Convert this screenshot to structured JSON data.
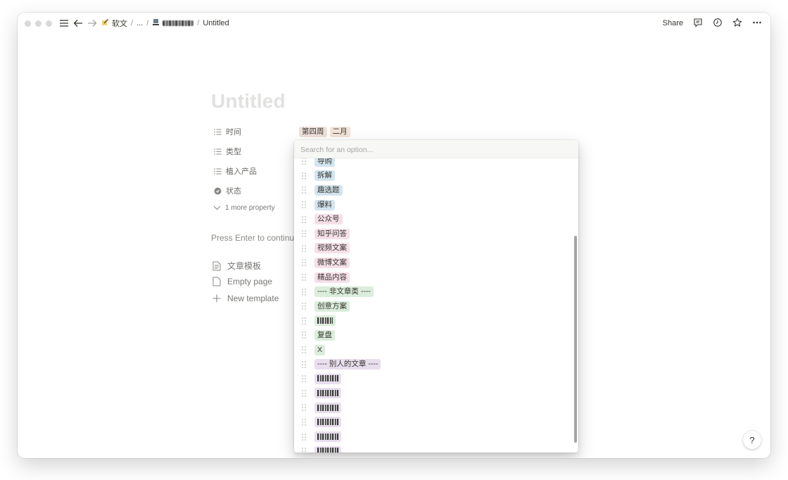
{
  "topbar": {
    "breadcrumb": [
      {
        "label": "软文",
        "icon": "pencil-note-icon"
      },
      {
        "label": "..."
      },
      {
        "label": "",
        "icon": "document-stack-icon",
        "redacted": true
      },
      {
        "label": "Untitled"
      }
    ],
    "share_label": "Share"
  },
  "page": {
    "title_placeholder": "Untitled",
    "properties": [
      {
        "label": "时间",
        "icon": "list-icon",
        "tags": [
          {
            "text": "第四周",
            "color": "#eee0da"
          },
          {
            "text": "二月",
            "color": "#f3e4d8"
          }
        ]
      },
      {
        "label": "类型",
        "icon": "list-icon",
        "tags": []
      },
      {
        "label": "植入产品",
        "icon": "list-icon",
        "tags": []
      },
      {
        "label": "状态",
        "icon": "status-icon",
        "tags": []
      }
    ],
    "more_properties": "1 more property",
    "enter_hint": "Press Enter to continue",
    "templates": [
      {
        "label": "文章模板",
        "icon": "page-text-icon"
      },
      {
        "label": "Empty page",
        "icon": "page-icon"
      },
      {
        "label": "New template",
        "icon": "plus-icon"
      }
    ]
  },
  "dropdown": {
    "search_placeholder": "Search for an option...",
    "options": [
      {
        "text": "导购",
        "color": "#d3e5ef"
      },
      {
        "text": "拆解",
        "color": "#d3e5ef"
      },
      {
        "text": "趣选题",
        "color": "#d3e5ef"
      },
      {
        "text": "爆料",
        "color": "#d3e5ef"
      },
      {
        "text": "公众号",
        "color": "#f5e0e9"
      },
      {
        "text": "知乎问答",
        "color": "#f5e0e9"
      },
      {
        "text": "视频文案",
        "color": "#f5e0e9"
      },
      {
        "text": "微博文案",
        "color": "#f5e0e9"
      },
      {
        "text": "精品内容",
        "color": "#f5e0e9"
      },
      {
        "text": "---- 非文章类 ----",
        "color": "#dbeddb"
      },
      {
        "text": "创意方案",
        "color": "#dbeddb"
      },
      {
        "text": "",
        "color": "#dbeddb",
        "redacted": true
      },
      {
        "text": "复盘",
        "color": "#dbeddb"
      },
      {
        "text": "X",
        "color": "#dbeddb"
      },
      {
        "text": "---- 别人的文章 ----",
        "color": "#e8deee"
      },
      {
        "text": "",
        "color": "#e8deee",
        "redacted": true
      },
      {
        "text": "",
        "color": "#e8deee",
        "redacted": true
      },
      {
        "text": "",
        "color": "#e8deee",
        "redacted": true
      },
      {
        "text": "",
        "color": "#e8deee",
        "redacted": true
      },
      {
        "text": "",
        "color": "#e8deee",
        "redacted": true
      },
      {
        "text": "",
        "color": "#e8deee",
        "redacted": true
      }
    ]
  },
  "help_label": "?"
}
